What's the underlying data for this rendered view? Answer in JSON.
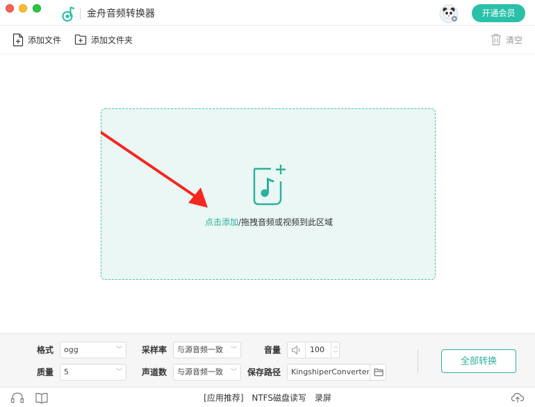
{
  "window": {
    "title": "金舟音频转换器"
  },
  "header": {
    "vip_button": "开通会员"
  },
  "toolbar": {
    "add_file": "添加文件",
    "add_folder": "添加文件夹",
    "clear": "清空"
  },
  "dropzone": {
    "link_text": "点击添加",
    "hint_text": "/拖拽音频或视频到此区域"
  },
  "settings": {
    "format_label": "格式",
    "format_value": "ogg",
    "quality_label": "质量",
    "quality_value": "5",
    "sample_rate_label": "采样率",
    "sample_rate_value": "与源音频一致",
    "channels_label": "声道数",
    "channels_value": "与源音频一致",
    "volume_label": "音量",
    "volume_value": "100",
    "save_path_label": "保存路径",
    "save_path_value": "KingshiperConverter",
    "convert_all": "全部转换"
  },
  "footer": {
    "links": [
      "[应用推荐]",
      "NTFS磁盘读写",
      "录屏"
    ]
  },
  "colors": {
    "accent": "#2bc0a8",
    "dropzone_bg": "#eaf7f4",
    "arrow": "#f5271f"
  },
  "icons": [
    "music-note-icon",
    "add-file-icon",
    "add-folder-icon",
    "trash-icon",
    "music-add-icon",
    "speaker-icon",
    "folder-icon",
    "headset-icon",
    "book-icon",
    "cloud-upload-icon"
  ]
}
